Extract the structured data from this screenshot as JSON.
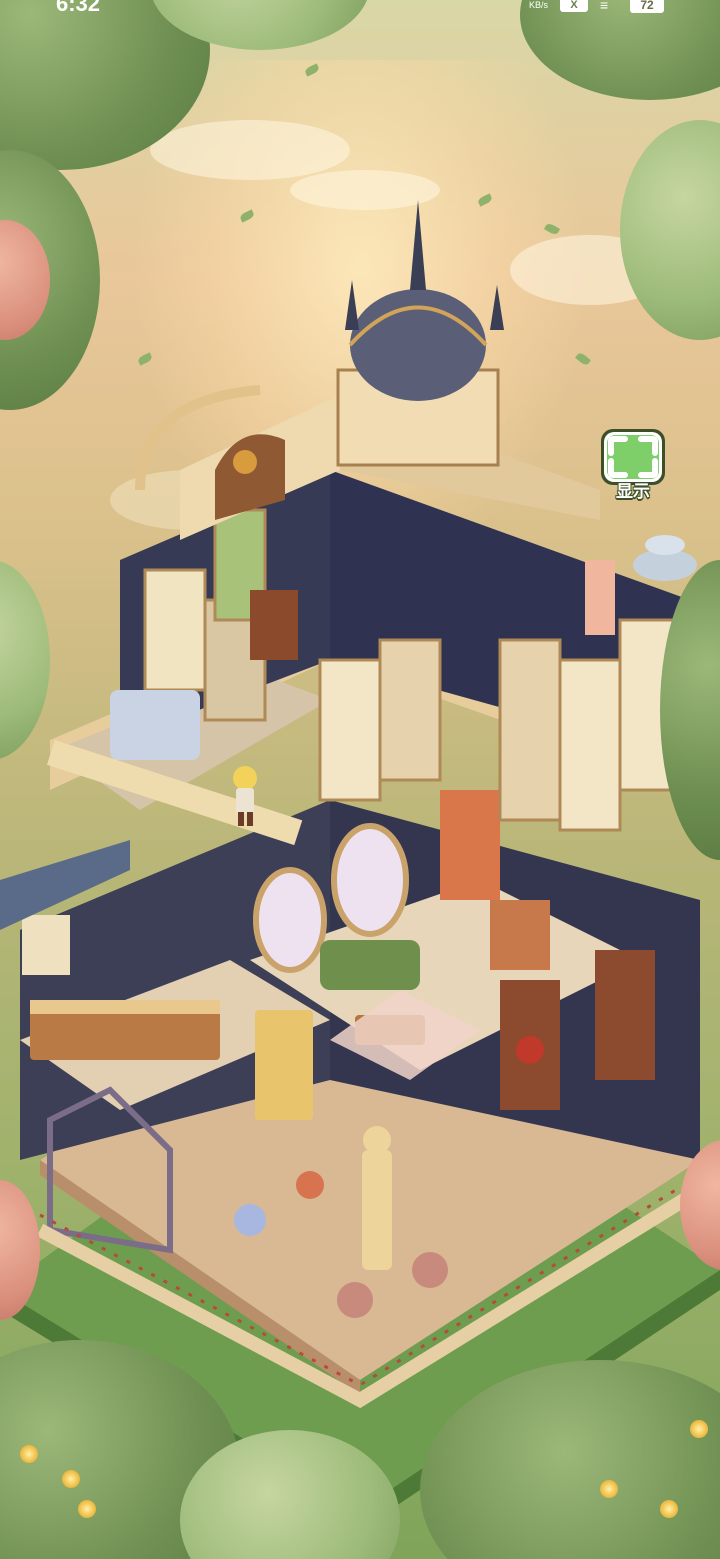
{
  "status_bar": {
    "time": "6:32",
    "network_speed": "KB/s",
    "x_badge": "X",
    "wifi": "≡",
    "battery": "72"
  },
  "display_toggle": {
    "label": "显示",
    "icon": "expand-view-icon"
  },
  "scene": {
    "name": "isometric-mansion-house",
    "character": "blonde-girl-character"
  },
  "colors": {
    "sky_top": "#d9d7a6",
    "sky_glow": "#ffecbe",
    "foliage": "#7d9e5d",
    "roof_dark": "#3a3f55",
    "wall_cream": "#f1e4c0",
    "wood": "#9b6a3f",
    "toggle_green": "#7ecf6a"
  }
}
